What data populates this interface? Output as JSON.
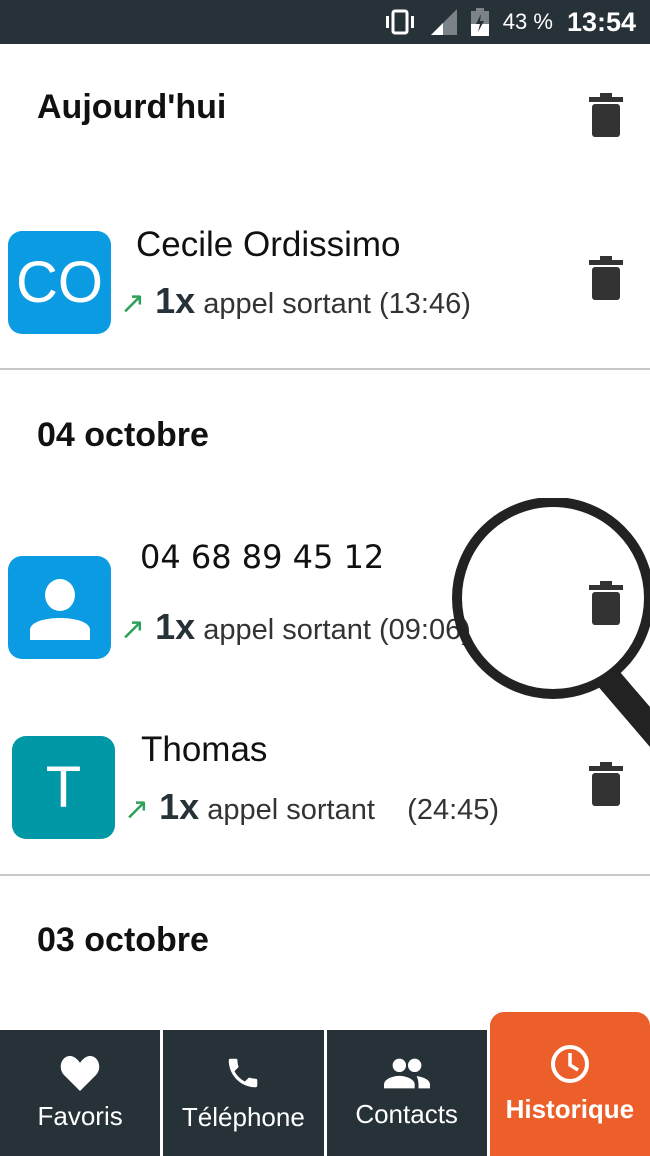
{
  "status_bar": {
    "battery": "43 %",
    "time": "13:54",
    "icons": [
      "vibrate-icon",
      "signal-icon",
      "battery-charging-icon"
    ]
  },
  "sections": [
    {
      "header": "Aujourd'hui",
      "calls": [
        {
          "initials": "CO",
          "name": "Cecile Ordissimo",
          "count": "1x",
          "type": "appel sortant",
          "time": "(13:46)",
          "color": "#0a9be3"
        }
      ]
    },
    {
      "header": "04 octobre",
      "calls": [
        {
          "initials": "",
          "name": "04 68 89 45 12",
          "count": "1x",
          "type": "appel sortant",
          "time": "(09:06)",
          "color": "#0a9be3"
        },
        {
          "initials": "T",
          "name": "Thomas",
          "count": "1x",
          "type": "appel sortant",
          "time": "(24:45)",
          "color": "#0097a7"
        }
      ]
    },
    {
      "header": "03 octobre",
      "calls": []
    }
  ],
  "nav": {
    "items": [
      {
        "label": "Favoris",
        "icon": "heart-icon"
      },
      {
        "label": "Téléphone",
        "icon": "phone-icon"
      },
      {
        "label": "Contacts",
        "icon": "contacts-icon"
      },
      {
        "label": "Historique",
        "icon": "clock-icon",
        "active": true
      }
    ],
    "active_color": "#ec5f2a"
  }
}
